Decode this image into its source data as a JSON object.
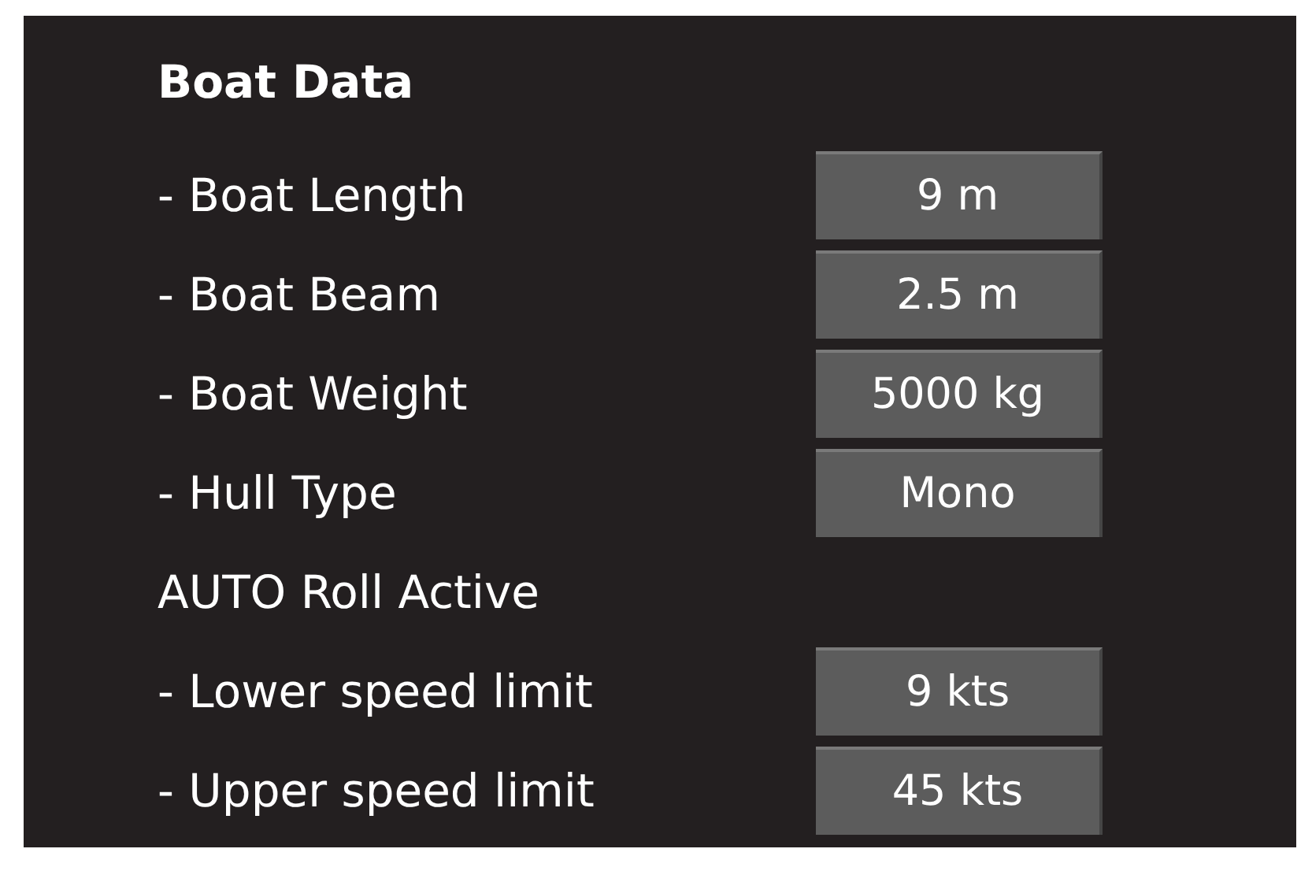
{
  "title": "Boat Data",
  "rows": [
    {
      "kind": "setting",
      "label": "- Boat Length",
      "value": "9 m"
    },
    {
      "kind": "setting",
      "label": "- Boat Beam",
      "value": "2.5 m"
    },
    {
      "kind": "setting",
      "label": "- Boat Weight",
      "value": "5000 kg"
    },
    {
      "kind": "setting",
      "label": "- Hull Type",
      "value": "Mono"
    },
    {
      "kind": "section",
      "label": "AUTO Roll Active"
    },
    {
      "kind": "setting",
      "label": "- Lower speed limit",
      "value": "9 kts"
    },
    {
      "kind": "setting",
      "label": "- Upper speed limit",
      "value": "45 kts"
    }
  ]
}
